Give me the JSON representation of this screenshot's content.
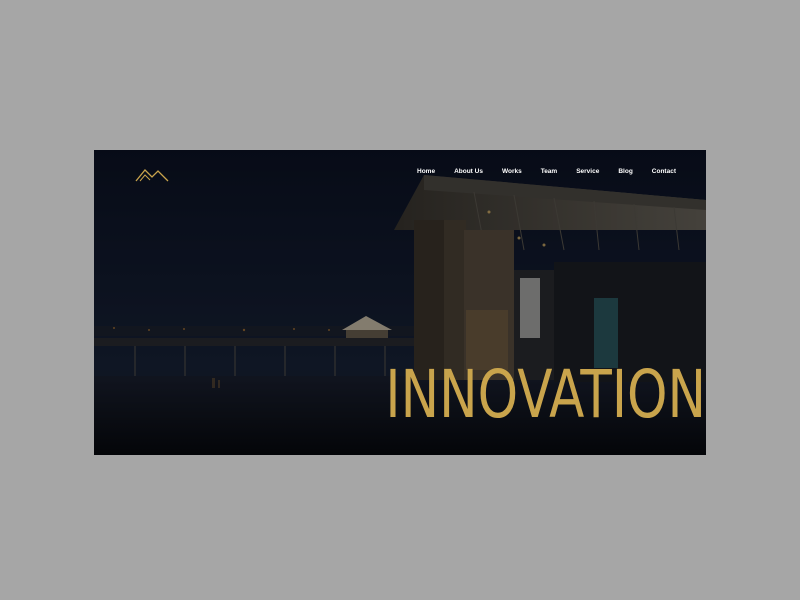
{
  "brand": {
    "logo_icon": "mountain-logo-icon",
    "accent_color": "#c9a44c"
  },
  "nav": {
    "items": [
      {
        "label": "Home"
      },
      {
        "label": "About Us"
      },
      {
        "label": "Works"
      },
      {
        "label": "Team"
      },
      {
        "label": "Service"
      },
      {
        "label": "Blog"
      },
      {
        "label": "Contact"
      }
    ]
  },
  "hero": {
    "title": "INNOVATION",
    "title_color": "#c9a44c",
    "background": "night-architecture-photo"
  }
}
